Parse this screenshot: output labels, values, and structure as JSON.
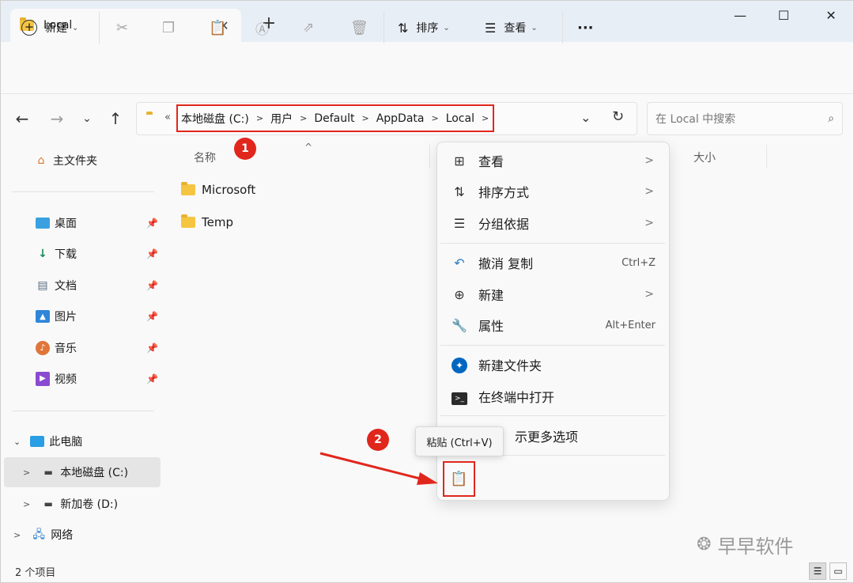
{
  "window": {
    "tab_title": "Local",
    "tab_close": "✕",
    "new_tab": "+",
    "minimize": "—",
    "maximize": "☐",
    "close": "✕"
  },
  "toolbar": {
    "new_label": "新建",
    "sort_label": "排序",
    "view_label": "查看",
    "more": "···"
  },
  "address": {
    "crumbs": [
      "本地磁盘 (C:)",
      "用户",
      "Default",
      "AppData",
      "Local"
    ],
    "overflow": "«",
    "search_placeholder": "在 Local 中搜索"
  },
  "sidebar": {
    "home": "主文件夹",
    "quick": [
      {
        "label": "桌面",
        "icon": "desktop-icon"
      },
      {
        "label": "下载",
        "icon": "download-icon"
      },
      {
        "label": "文档",
        "icon": "document-icon"
      },
      {
        "label": "图片",
        "icon": "picture-icon"
      },
      {
        "label": "音乐",
        "icon": "music-icon"
      },
      {
        "label": "视频",
        "icon": "video-icon"
      }
    ],
    "this_pc": "此电脑",
    "drive_c": "本地磁盘 (C:)",
    "drive_d": "新加卷 (D:)",
    "network": "网络"
  },
  "list": {
    "col_name": "名称",
    "col_size": "大小",
    "files": [
      "Microsoft",
      "Temp"
    ]
  },
  "context_menu": {
    "view": "查看",
    "sort": "排序方式",
    "group": "分组依据",
    "undo": "撤消 复制",
    "undo_shortcut": "Ctrl+Z",
    "new": "新建",
    "properties": "属性",
    "properties_shortcut": "Alt+Enter",
    "new_folder": "新建文件夹",
    "open_terminal": "在终端中打开",
    "more_options": "示更多选项"
  },
  "tooltip": "粘贴 (Ctrl+V)",
  "annotations": {
    "badge1": "1",
    "badge2": "2"
  },
  "status": "2 个项目",
  "watermark": "早早软件",
  "colors": {
    "highlight": "#e1261c",
    "accent": "#0067c0"
  }
}
